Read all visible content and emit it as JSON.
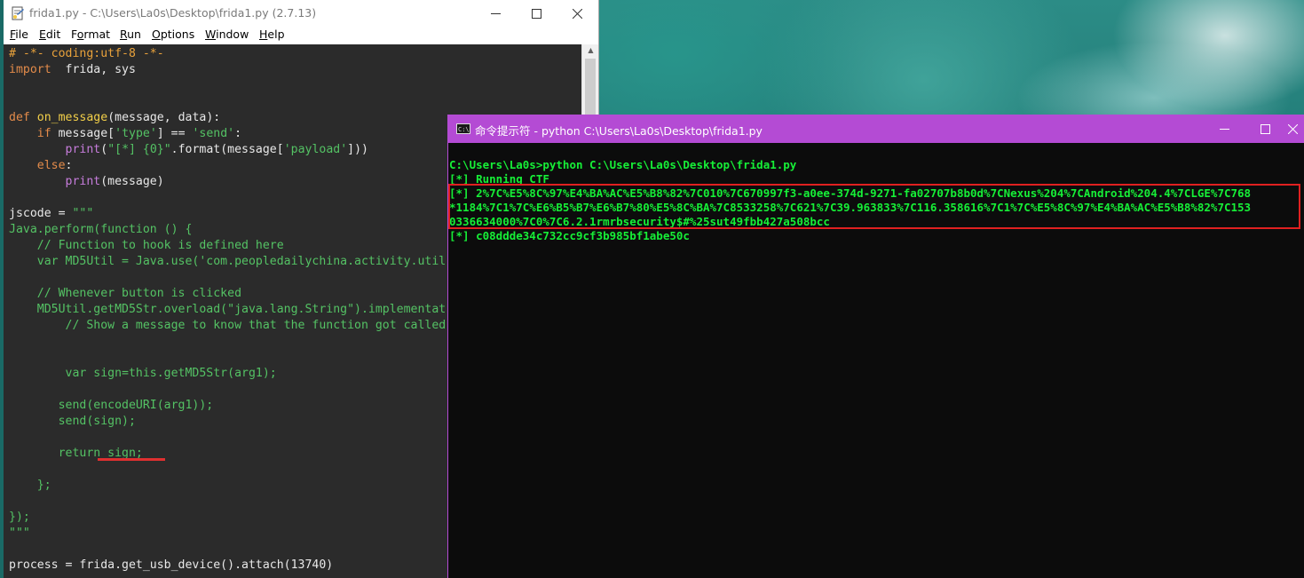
{
  "idle": {
    "title": "frida1.py - C:\\Users\\La0s\\Desktop\\frida1.py (2.7.13)",
    "menu": [
      {
        "m": "F",
        "rest": "ile"
      },
      {
        "m": "E",
        "rest": "dit"
      },
      {
        "m": "",
        "rest": "Format",
        "pre": "F",
        "under": "o",
        "post": "rmat"
      },
      {
        "m": "R",
        "rest": "un"
      },
      {
        "m": "O",
        "rest": "ptions"
      },
      {
        "m": "W",
        "rest": "indow"
      },
      {
        "m": "H",
        "rest": "elp"
      }
    ],
    "code_lines": [
      [
        [
          "c-com",
          "# -*- coding:utf-8 -*-"
        ]
      ],
      [
        [
          "c-kw",
          "import"
        ],
        [
          "",
          "  frida, sys"
        ]
      ],
      [],
      [],
      [
        [
          "c-kw",
          "def"
        ],
        [
          "",
          " "
        ],
        [
          "c-fn",
          "on_message"
        ],
        [
          "",
          "(message, data):"
        ]
      ],
      [
        [
          "",
          "    "
        ],
        [
          "c-kw",
          "if"
        ],
        [
          "",
          " message["
        ],
        [
          "c-str",
          "'type'"
        ],
        [
          "",
          "] == "
        ],
        [
          "c-str",
          "'send'"
        ],
        [
          "",
          ":"
        ]
      ],
      [
        [
          "",
          "        "
        ],
        [
          "c-bi",
          "print"
        ],
        [
          "",
          "("
        ],
        [
          "c-str",
          "\"[*] {0}\""
        ],
        [
          "",
          ".format(message["
        ],
        [
          "c-str",
          "'payload'"
        ],
        [
          "",
          "]))"
        ]
      ],
      [
        [
          "",
          "    "
        ],
        [
          "c-kw",
          "else"
        ],
        [
          "",
          ":"
        ]
      ],
      [
        [
          "",
          "        "
        ],
        [
          "c-bi",
          "print"
        ],
        [
          "",
          "(message)"
        ]
      ],
      [],
      [
        [
          "",
          "jscode = "
        ],
        [
          "c-str",
          "\"\"\""
        ]
      ],
      [
        [
          "c-str",
          "Java.perform(function () {"
        ]
      ],
      [
        [
          "c-str",
          "    // Function to hook is defined here"
        ]
      ],
      [
        [
          "c-str",
          "    var MD5Util = Java.use('com.peopledailychina.activity.util"
        ]
      ],
      [],
      [
        [
          "c-str",
          "    // Whenever button is clicked"
        ]
      ],
      [
        [
          "c-str",
          "    MD5Util.getMD5Str.overload(\"java.lang.String\").implementat"
        ]
      ],
      [
        [
          "c-str",
          "        // Show a message to know that the function got called"
        ]
      ],
      [],
      [],
      [
        [
          "c-str",
          "        var sign=this.getMD5Str(arg1);"
        ]
      ],
      [],
      [
        [
          "c-str",
          "       send(encodeURI(arg1));"
        ]
      ],
      [
        [
          "c-str",
          "       send(sign);"
        ]
      ],
      [],
      [
        [
          "c-str",
          "       return sign;"
        ]
      ],
      [],
      [
        [
          "c-str",
          "    };"
        ]
      ],
      [],
      [
        [
          "c-str",
          "});"
        ]
      ],
      [
        [
          "c-str",
          "\"\"\""
        ]
      ],
      [],
      [
        [
          "",
          "process = frida.get_usb_device().attach(13740)"
        ]
      ]
    ]
  },
  "cmd": {
    "title": "命令提示符 - python  C:\\Users\\La0s\\Desktop\\frida1.py",
    "icon_text": "C:\\",
    "lines": [
      "C:\\Users\\La0s>python C:\\Users\\La0s\\Desktop\\frida1.py",
      "[*] Running CTF",
      "[*] 2%7C%E5%8C%97%E4%BA%AC%E5%B8%82%7C010%7C670997f3-a0ee-374d-9271-fa02707b8b0d%7CNexus%204%7CAndroid%204.4%7CLGE%7C768",
      "*1184%7C1%7C%E6%B5%B7%E6%B7%80%E5%8C%BA%7C8533258%7C621%7C39.963833%7C116.358616%7C1%7C%E5%8C%97%E4%BA%AC%E5%B8%82%7C153",
      "0336634000%7C0%7C6.2.1rmrbsecurity$#%25sut49fbb427a508bcc",
      "[*] c08ddde34c732cc9cf3b985bf1abe50c"
    ]
  },
  "colors": {
    "cmd_title_bg": "#b44bd4",
    "cmd_text": "#16ef37",
    "highlight": "#e02020",
    "editor_bg": "#2b2b2b"
  }
}
